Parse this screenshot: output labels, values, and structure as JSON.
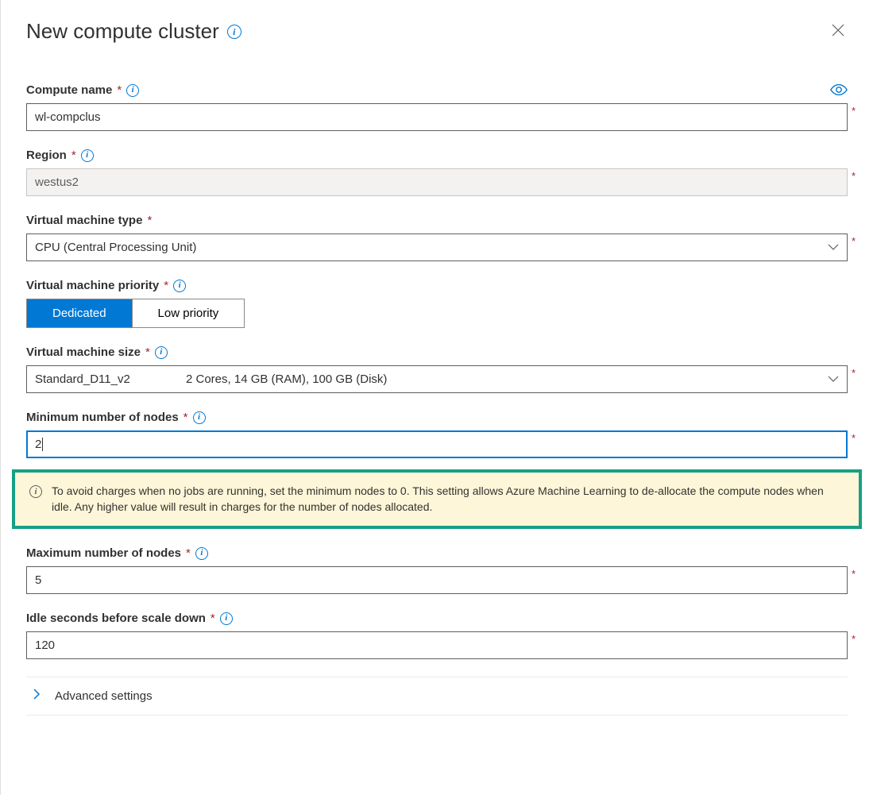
{
  "header": {
    "title": "New compute cluster"
  },
  "fields": {
    "compute_name": {
      "label": "Compute name",
      "value": "wl-compclus"
    },
    "region": {
      "label": "Region",
      "value": "westus2"
    },
    "vm_type": {
      "label": "Virtual machine type",
      "value": "CPU (Central Processing Unit)"
    },
    "vm_priority": {
      "label": "Virtual machine priority",
      "option_a": "Dedicated",
      "option_b": "Low priority"
    },
    "vm_size": {
      "label": "Virtual machine size",
      "name": "Standard_D11_v2",
      "spec": "2 Cores, 14 GB (RAM), 100 GB (Disk)"
    },
    "min_nodes": {
      "label": "Minimum number of nodes",
      "value": "2"
    },
    "max_nodes": {
      "label": "Maximum number of nodes",
      "value": "5"
    },
    "idle_seconds": {
      "label": "Idle seconds before scale down",
      "value": "120"
    }
  },
  "warning": {
    "text": "To avoid charges when no jobs are running, set the minimum nodes to 0. This setting allows Azure Machine Learning to de-allocate the compute nodes when idle. Any higher value will result in charges for the number of nodes allocated."
  },
  "advanced": {
    "label": "Advanced settings"
  }
}
